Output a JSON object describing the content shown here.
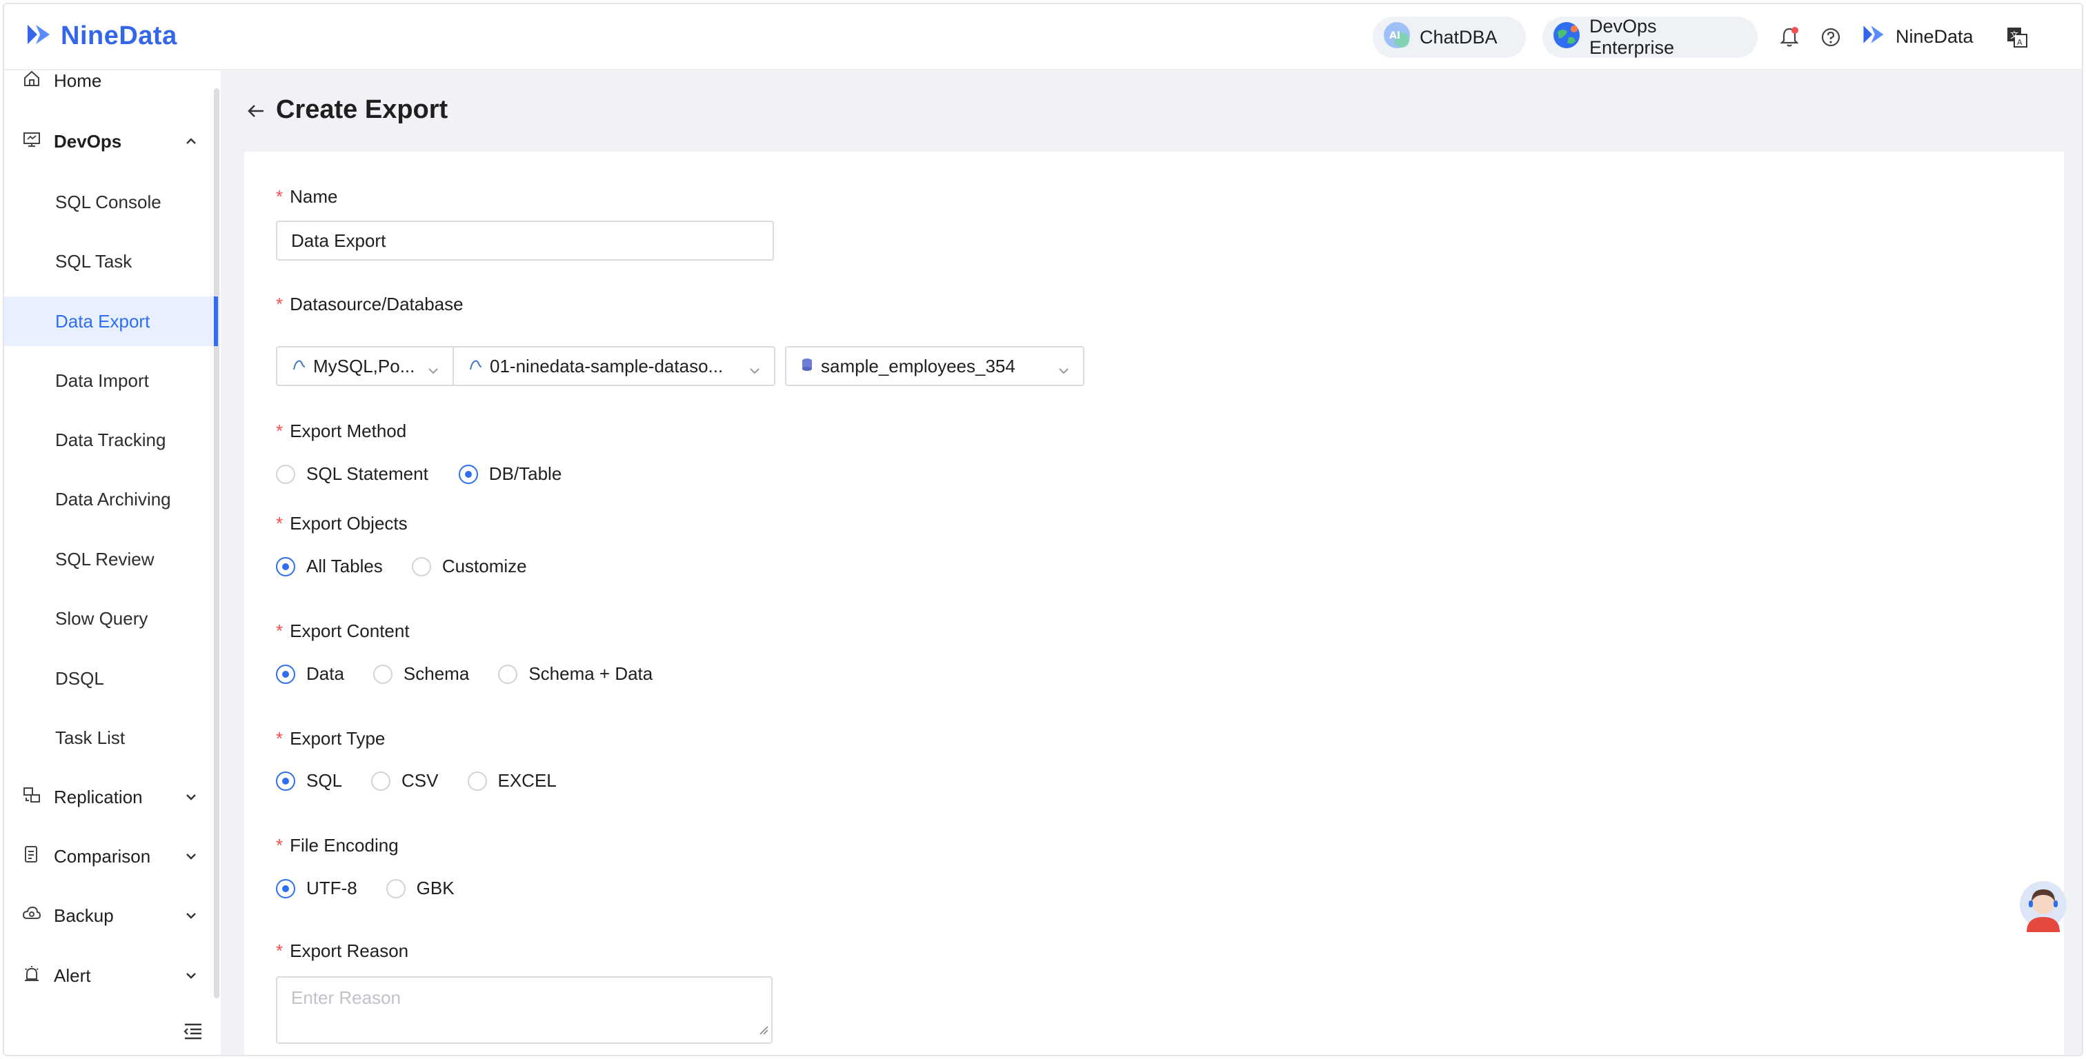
{
  "app": {
    "logo_text": "NineData",
    "brand_color": "#3366e8",
    "accent_color": "#2f6ef1"
  },
  "header": {
    "chatdba_label": "ChatDBA",
    "edition_label": "DevOps Enterprise",
    "user_name": "NineData",
    "icons": [
      "bell-icon",
      "help-icon",
      "language-icon"
    ]
  },
  "sidebar": {
    "home": "Home",
    "devops": "DevOps",
    "devops_items": [
      {
        "label": "SQL Console"
      },
      {
        "label": "SQL Task"
      },
      {
        "label": "Data Export"
      },
      {
        "label": "Data Import"
      },
      {
        "label": "Data Tracking"
      },
      {
        "label": "Data Archiving"
      },
      {
        "label": "SQL Review"
      },
      {
        "label": "Slow Query"
      },
      {
        "label": "DSQL"
      },
      {
        "label": "Task List"
      }
    ],
    "active_item": "Data Export",
    "groups": [
      {
        "label": "Replication"
      },
      {
        "label": "Comparison"
      },
      {
        "label": "Backup"
      },
      {
        "label": "Alert"
      }
    ]
  },
  "page": {
    "title": "Create Export"
  },
  "form": {
    "name": {
      "label": "Name",
      "value": "Data Export"
    },
    "datasource": {
      "label": "Datasource/Database",
      "type_value": "MySQL,Po...",
      "datasource_value": "01-ninedata-sample-dataso...",
      "database_value": "sample_employees_354"
    },
    "export_method": {
      "label": "Export Method",
      "options": [
        "SQL Statement",
        "DB/Table"
      ],
      "selected": "DB/Table"
    },
    "export_objects": {
      "label": "Export Objects",
      "options": [
        "All Tables",
        "Customize"
      ],
      "selected": "All Tables"
    },
    "export_content": {
      "label": "Export Content",
      "options": [
        "Data",
        "Schema",
        "Schema + Data"
      ],
      "selected": "Data"
    },
    "export_type": {
      "label": "Export Type",
      "options": [
        "SQL",
        "CSV",
        "EXCEL"
      ],
      "selected": "SQL"
    },
    "file_encoding": {
      "label": "File Encoding",
      "options": [
        "UTF-8",
        "GBK"
      ],
      "selected": "UTF-8"
    },
    "export_reason": {
      "label": "Export Reason",
      "placeholder": "Enter Reason"
    },
    "required_mark": "*"
  }
}
